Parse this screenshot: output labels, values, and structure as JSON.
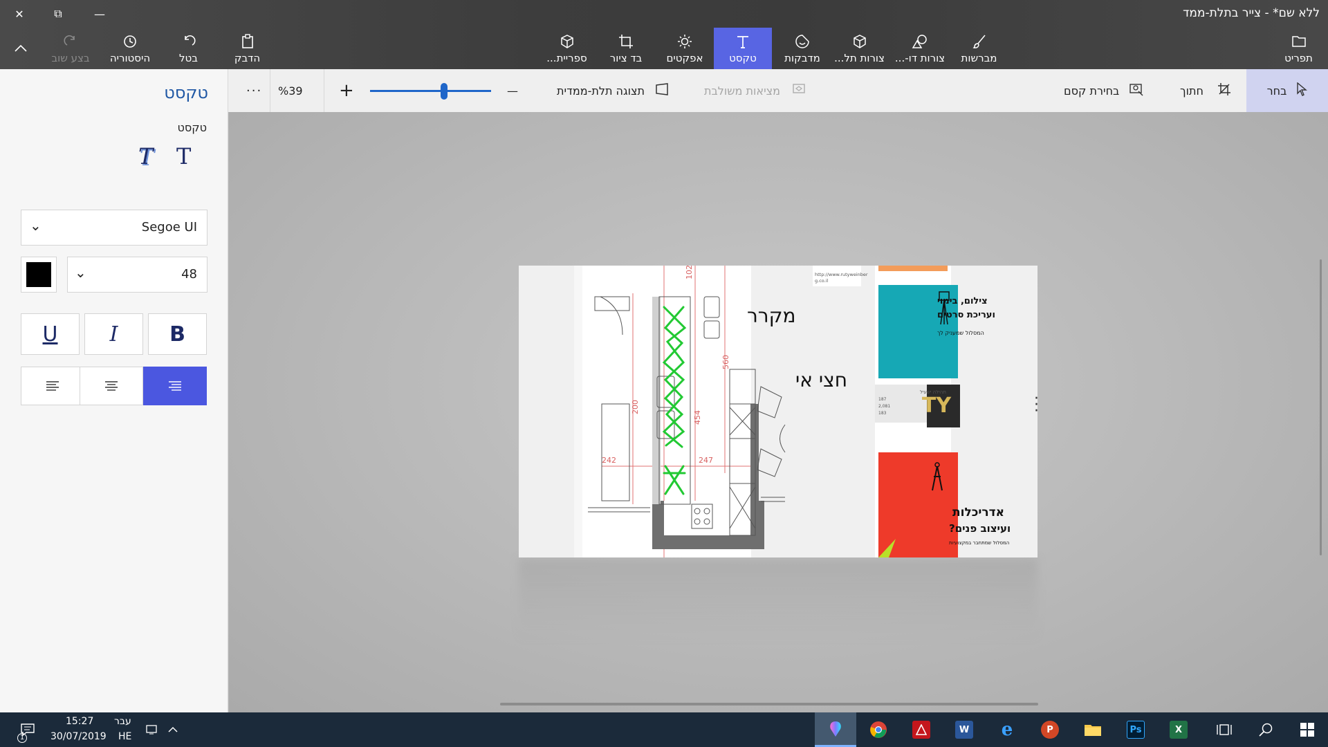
{
  "window": {
    "title": "ללא שם* - צייר בתלת-ממד",
    "close_glyph": "✕",
    "restore_glyph": "⧉",
    "min_glyph": "—"
  },
  "ribbon": {
    "collapse_glyph": "^",
    "menu": "תפריט",
    "brushes": "מברשות",
    "shapes_2d": "צורות דו-...",
    "shapes_3d": "צורות תל...",
    "stickers": "מדבקות",
    "text": "טקסט",
    "effects": "אפקטים",
    "canvas": "בד ציור",
    "library": "ספריית...",
    "paste": "הדבק",
    "undo": "בטל",
    "history": "היסטוריה",
    "redo": "בצע שוב"
  },
  "subbar": {
    "select": "בחר",
    "crop": "חתוך",
    "magic_select": "בחירת קסם",
    "mixed_reality": "מציאות משולבת",
    "view_3d": "תצוגה תלת-ממדית",
    "zoom_minus": "—",
    "zoom_plus": "+",
    "zoom_value": "%39",
    "more": "···",
    "zoom_fraction": 0.39
  },
  "panel": {
    "title": "טקסט",
    "subtitle": "טקסט",
    "text_2d_glyph": "T",
    "text_3d_glyph": "T",
    "font": "Segoe UI",
    "size": "48",
    "color": "#000000",
    "underline": "U",
    "italic": "I",
    "bold": "B",
    "chevron": "⌄"
  },
  "canvas": {
    "label_fridge": "מקרר",
    "label_half_island": "חצי אי",
    "dim_102": "102",
    "dim_560": "560",
    "dim_200": "200",
    "dim_454": "454",
    "dim_242": "242",
    "dim_247": "247",
    "url_text": "http://www.rutyweinber",
    "url_text2": "g.co.il",
    "ad1_line1": "צילום, בימוי",
    "ad1_line2": "ועריכת סרטים",
    "ad1_line3": "המסלול שמעניק לך",
    "ad2_line1": "תהילה ישעיל",
    "ad2_n1": "187",
    "ad2_n2": "2,081",
    "ad2_n3": "183",
    "ad3_line1": "אדריכלות",
    "ad3_line2": "ועיצוב פנים?",
    "ad3_line3": "המסלול שמתחבר במקצועיות"
  },
  "taskbar": {
    "time": "15:27",
    "date": "30/07/2019",
    "lang_top": "עבר",
    "lang_bottom": "HE",
    "notif_count": "1",
    "apps": [
      "paint3d",
      "chrome",
      "acrobat",
      "word",
      "edge",
      "powerpoint",
      "explorer",
      "photoshop",
      "excel"
    ],
    "word_glyph": "W",
    "ppt_glyph": "P",
    "ps_glyph": "Ps",
    "xl_glyph": "X",
    "edge_glyph": "e"
  }
}
